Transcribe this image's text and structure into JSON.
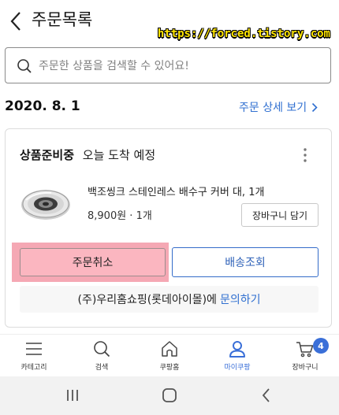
{
  "header": {
    "title": "주문목록",
    "watermark": "https://forced.tistory.com"
  },
  "search": {
    "placeholder": "주문한 상품을 검색할 수 있어요!"
  },
  "order": {
    "date": "2020. 8. 1",
    "detail_link": "주문 상세 보기",
    "status": "상품준비중",
    "arrival": "오늘 도착 예정",
    "product_name": "백조씽크 스테인레스 배수구 커버 대, 1개",
    "price_qty": "8,900원 · 1개",
    "cart_button": "장바구니 담기",
    "cancel_button": "주문취소",
    "shipping_button": "배송조회",
    "seller_text": "(주)우리홈쇼핑(롯데아이몰)에",
    "inquiry_link": "문의하기"
  },
  "tabbar": {
    "items": [
      {
        "label": "카테고리",
        "icon": "menu-icon"
      },
      {
        "label": "검색",
        "icon": "search-icon"
      },
      {
        "label": "쿠팡홈",
        "icon": "home-icon"
      },
      {
        "label": "마이쿠팡",
        "icon": "person-icon",
        "active": true
      },
      {
        "label": "장바구니",
        "icon": "cart-icon",
        "badge": "4"
      }
    ]
  },
  "system_nav": {
    "buttons": [
      "recents-icon",
      "home-icon",
      "back-icon"
    ]
  },
  "colors": {
    "accent": "#2f6fd0",
    "highlight": "#f5a8b4",
    "watermark": "#ffe600"
  }
}
